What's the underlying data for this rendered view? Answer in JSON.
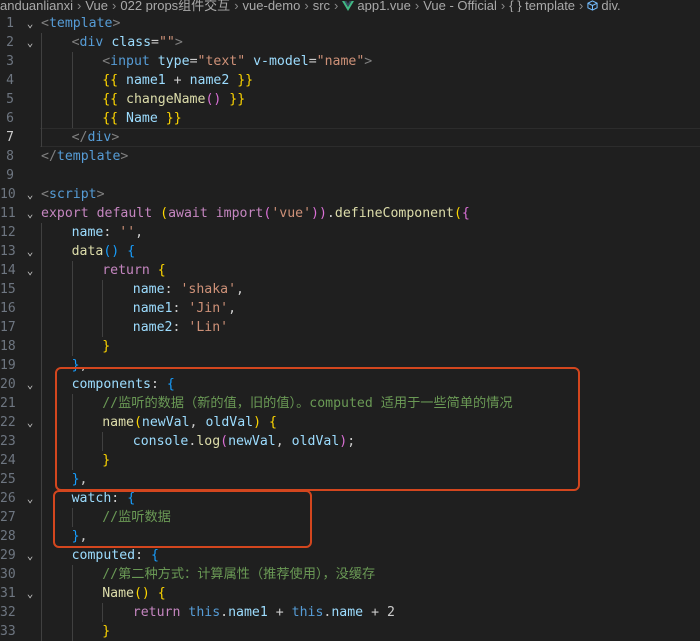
{
  "breadcrumb": {
    "items": [
      "anduanlianxi",
      "Vue",
      "022 props组件交互",
      "vue-demo",
      "src",
      "app1.vue",
      "Vue - Official",
      "{ } template",
      "div."
    ],
    "vue_icon": "vue-logo-icon",
    "cube_icon": "cube-icon"
  },
  "editor": {
    "active_line": 7,
    "lines": [
      {
        "n": "1",
        "indent": 0,
        "fold": "v",
        "tokens": [
          [
            "tk-punct",
            "<"
          ],
          [
            "tk-tag",
            "template"
          ],
          [
            "tk-punct",
            ">"
          ]
        ]
      },
      {
        "n": "2",
        "indent": 1,
        "fold": "v",
        "tokens": [
          [
            "tk-punct",
            "<"
          ],
          [
            "tk-tag",
            "div"
          ],
          [
            "tk-plain",
            " "
          ],
          [
            "tk-attr",
            "class"
          ],
          [
            "tk-plain",
            "="
          ],
          [
            "tk-str",
            "\"\""
          ],
          [
            "tk-punct",
            ">"
          ]
        ]
      },
      {
        "n": "3",
        "indent": 2,
        "fold": "",
        "tokens": [
          [
            "tk-punct",
            "<"
          ],
          [
            "tk-tag",
            "input"
          ],
          [
            "tk-plain",
            " "
          ],
          [
            "tk-attr",
            "type"
          ],
          [
            "tk-plain",
            "="
          ],
          [
            "tk-str",
            "\"text\""
          ],
          [
            "tk-plain",
            " "
          ],
          [
            "tk-attr",
            "v-model"
          ],
          [
            "tk-plain",
            "="
          ],
          [
            "tk-str",
            "\"name\""
          ],
          [
            "tk-punct",
            ">"
          ]
        ]
      },
      {
        "n": "4",
        "indent": 2,
        "fold": "",
        "tokens": [
          [
            "tk-br1",
            "{{"
          ],
          [
            "tk-plain",
            " "
          ],
          [
            "tk-var",
            "name1"
          ],
          [
            "tk-plain",
            " + "
          ],
          [
            "tk-var",
            "name2"
          ],
          [
            "tk-plain",
            " "
          ],
          [
            "tk-br1",
            "}}"
          ]
        ]
      },
      {
        "n": "5",
        "indent": 2,
        "fold": "",
        "tokens": [
          [
            "tk-br1",
            "{{"
          ],
          [
            "tk-plain",
            " "
          ],
          [
            "tk-fn",
            "changeName"
          ],
          [
            "tk-br2",
            "()"
          ],
          [
            "tk-plain",
            " "
          ],
          [
            "tk-br1",
            "}}"
          ]
        ]
      },
      {
        "n": "6",
        "indent": 2,
        "fold": "",
        "tokens": [
          [
            "tk-br1",
            "{{"
          ],
          [
            "tk-plain",
            " "
          ],
          [
            "tk-var",
            "Name"
          ],
          [
            "tk-plain",
            " "
          ],
          [
            "tk-br1",
            "}}"
          ]
        ]
      },
      {
        "n": "7",
        "indent": 1,
        "fold": "",
        "tokens": [
          [
            "tk-punct",
            "</"
          ],
          [
            "tk-tag",
            "div"
          ],
          [
            "tk-punct",
            ">"
          ]
        ]
      },
      {
        "n": "8",
        "indent": 0,
        "fold": "",
        "tokens": [
          [
            "tk-punct",
            "</"
          ],
          [
            "tk-tag",
            "template"
          ],
          [
            "tk-punct",
            ">"
          ]
        ]
      },
      {
        "n": "9",
        "indent": 0,
        "fold": "",
        "tokens": []
      },
      {
        "n": "10",
        "indent": 0,
        "fold": "v",
        "tokens": [
          [
            "tk-punct",
            "<"
          ],
          [
            "tk-tag",
            "script"
          ],
          [
            "tk-punct",
            ">"
          ]
        ]
      },
      {
        "n": "11",
        "indent": 0,
        "fold": "v",
        "tokens": [
          [
            "tk-kw",
            "export"
          ],
          [
            "tk-plain",
            " "
          ],
          [
            "tk-kw",
            "default"
          ],
          [
            "tk-plain",
            " "
          ],
          [
            "tk-br1",
            "("
          ],
          [
            "tk-kw",
            "await"
          ],
          [
            "tk-plain",
            " "
          ],
          [
            "tk-kw",
            "import"
          ],
          [
            "tk-br2",
            "("
          ],
          [
            "tk-str",
            "'vue'"
          ],
          [
            "tk-br2",
            "))"
          ],
          [
            "tk-plain",
            "."
          ],
          [
            "tk-fn",
            "defineComponent"
          ],
          [
            "tk-br1",
            "("
          ],
          [
            "tk-br2",
            "{"
          ]
        ]
      },
      {
        "n": "12",
        "indent": 1,
        "fold": "",
        "tokens": [
          [
            "tk-var",
            "name"
          ],
          [
            "tk-plain",
            ": "
          ],
          [
            "tk-str",
            "''"
          ],
          [
            "tk-plain",
            ","
          ]
        ]
      },
      {
        "n": "13",
        "indent": 1,
        "fold": "v",
        "tokens": [
          [
            "tk-fn",
            "data"
          ],
          [
            "tk-br3",
            "()"
          ],
          [
            "tk-plain",
            " "
          ],
          [
            "tk-br3",
            "{"
          ]
        ]
      },
      {
        "n": "14",
        "indent": 2,
        "fold": "v",
        "tokens": [
          [
            "tk-kw",
            "return"
          ],
          [
            "tk-plain",
            " "
          ],
          [
            "tk-br1",
            "{"
          ]
        ]
      },
      {
        "n": "15",
        "indent": 3,
        "fold": "",
        "tokens": [
          [
            "tk-var",
            "name"
          ],
          [
            "tk-plain",
            ": "
          ],
          [
            "tk-str",
            "'shaka'"
          ],
          [
            "tk-plain",
            ","
          ]
        ]
      },
      {
        "n": "16",
        "indent": 3,
        "fold": "",
        "tokens": [
          [
            "tk-var",
            "name1"
          ],
          [
            "tk-plain",
            ": "
          ],
          [
            "tk-str",
            "'Jin'"
          ],
          [
            "tk-plain",
            ","
          ]
        ]
      },
      {
        "n": "17",
        "indent": 3,
        "fold": "",
        "tokens": [
          [
            "tk-var",
            "name2"
          ],
          [
            "tk-plain",
            ": "
          ],
          [
            "tk-str",
            "'Lin'"
          ]
        ]
      },
      {
        "n": "18",
        "indent": 2,
        "fold": "",
        "tokens": [
          [
            "tk-br1",
            "}"
          ]
        ]
      },
      {
        "n": "19",
        "indent": 1,
        "fold": "",
        "tokens": [
          [
            "tk-br3",
            "}"
          ],
          [
            "tk-plain",
            ","
          ]
        ]
      },
      {
        "n": "20",
        "indent": 1,
        "fold": "v",
        "tokens": [
          [
            "tk-var",
            "components"
          ],
          [
            "tk-plain",
            ": "
          ],
          [
            "tk-br3",
            "{"
          ]
        ]
      },
      {
        "n": "21",
        "indent": 2,
        "fold": "",
        "tokens": [
          [
            "tk-cmt",
            "//监听的数据（新的值，旧的值）。computed 适用于一些简单的情况"
          ]
        ]
      },
      {
        "n": "22",
        "indent": 2,
        "fold": "v",
        "tokens": [
          [
            "tk-fn",
            "name"
          ],
          [
            "tk-br1",
            "("
          ],
          [
            "tk-var",
            "newVal"
          ],
          [
            "tk-plain",
            ", "
          ],
          [
            "tk-var",
            "oldVal"
          ],
          [
            "tk-br1",
            ")"
          ],
          [
            "tk-plain",
            " "
          ],
          [
            "tk-br1",
            "{"
          ]
        ]
      },
      {
        "n": "23",
        "indent": 3,
        "fold": "",
        "tokens": [
          [
            "tk-var",
            "console"
          ],
          [
            "tk-plain",
            "."
          ],
          [
            "tk-fn",
            "log"
          ],
          [
            "tk-br2",
            "("
          ],
          [
            "tk-var",
            "newVal"
          ],
          [
            "tk-plain",
            ", "
          ],
          [
            "tk-var",
            "oldVal"
          ],
          [
            "tk-br2",
            ")"
          ],
          [
            "tk-plain",
            ";"
          ]
        ]
      },
      {
        "n": "24",
        "indent": 2,
        "fold": "",
        "tokens": [
          [
            "tk-br1",
            "}"
          ]
        ]
      },
      {
        "n": "25",
        "indent": 1,
        "fold": "",
        "tokens": [
          [
            "tk-br3",
            "}"
          ],
          [
            "tk-plain",
            ","
          ]
        ]
      },
      {
        "n": "26",
        "indent": 1,
        "fold": "v",
        "tokens": [
          [
            "tk-var",
            "watch"
          ],
          [
            "tk-plain",
            ": "
          ],
          [
            "tk-br3",
            "{"
          ]
        ]
      },
      {
        "n": "27",
        "indent": 2,
        "fold": "",
        "tokens": [
          [
            "tk-cmt",
            "//监听数据"
          ]
        ]
      },
      {
        "n": "28",
        "indent": 1,
        "fold": "",
        "tokens": [
          [
            "tk-br3",
            "}"
          ],
          [
            "tk-plain",
            ","
          ]
        ]
      },
      {
        "n": "29",
        "indent": 1,
        "fold": "v",
        "tokens": [
          [
            "tk-var",
            "computed"
          ],
          [
            "tk-plain",
            ": "
          ],
          [
            "tk-br3",
            "{"
          ]
        ]
      },
      {
        "n": "30",
        "indent": 2,
        "fold": "",
        "tokens": [
          [
            "tk-cmt",
            "//第二种方式：计算属性（推荐使用），没缓存"
          ]
        ]
      },
      {
        "n": "31",
        "indent": 2,
        "fold": "v",
        "tokens": [
          [
            "tk-fn",
            "Name"
          ],
          [
            "tk-br1",
            "()"
          ],
          [
            "tk-plain",
            " "
          ],
          [
            "tk-br1",
            "{"
          ]
        ]
      },
      {
        "n": "32",
        "indent": 3,
        "fold": "",
        "tokens": [
          [
            "tk-kw",
            "return"
          ],
          [
            "tk-plain",
            " "
          ],
          [
            "tk-kwb",
            "this"
          ],
          [
            "tk-plain",
            "."
          ],
          [
            "tk-var",
            "name1"
          ],
          [
            "tk-plain",
            " + "
          ],
          [
            "tk-kwb",
            "this"
          ],
          [
            "tk-plain",
            "."
          ],
          [
            "tk-var",
            "name"
          ],
          [
            "tk-plain",
            " + 2"
          ]
        ]
      },
      {
        "n": "33",
        "indent": 2,
        "fold": "",
        "tokens": [
          [
            "tk-br1",
            "}"
          ]
        ]
      }
    ]
  },
  "annotations": {
    "color": "#d3461e",
    "boxes": [
      "components-block",
      "watch-block"
    ]
  }
}
